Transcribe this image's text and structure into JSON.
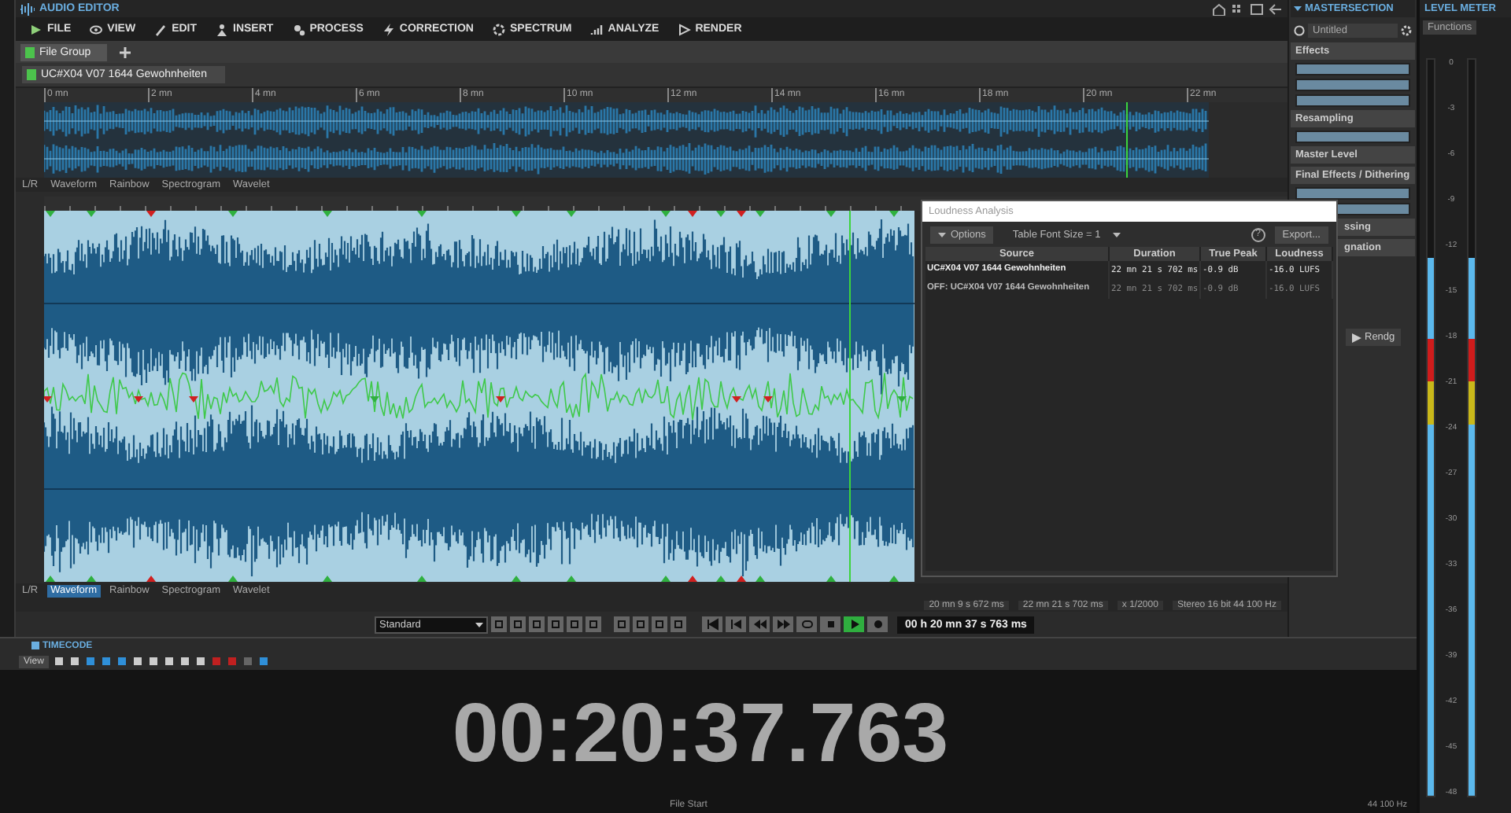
{
  "window": {
    "title": "AUDIO EDITOR"
  },
  "menu": [
    "FILE",
    "VIEW",
    "EDIT",
    "INSERT",
    "PROCESS",
    "CORRECTION",
    "SPECTRUM",
    "ANALYZE",
    "RENDER"
  ],
  "file_group_tab": "File Group",
  "file_tab": "UC#X04 V07 1644 Gewohnheiten",
  "overview": {
    "ruler": [
      "0 mn",
      "2 mn",
      "4 mn",
      "6 mn",
      "8 mn",
      "10 mn",
      "12 mn",
      "14 mn",
      "16 mn",
      "18 mn",
      "20 mn",
      "22 mn"
    ],
    "channel_label": "L/R",
    "view_tabs": [
      {
        "label": "Waveform",
        "selected": false
      },
      {
        "label": "Rainbow",
        "selected": false
      },
      {
        "label": "Spectrogram",
        "selected": false
      },
      {
        "label": "Wavelet",
        "selected": false
      }
    ]
  },
  "main_view": {
    "channel_label": "L/R",
    "view_tabs": [
      {
        "label": "Waveform",
        "selected": true
      },
      {
        "label": "Rainbow",
        "selected": false
      },
      {
        "label": "Spectrogram",
        "selected": false
      },
      {
        "label": "Wavelet",
        "selected": false
      }
    ],
    "status": [
      "20 mn 9 s 672 ms",
      "22 mn 21 s 702 ms",
      "x 1/2000",
      "Stereo 16 bit 44 100 Hz"
    ]
  },
  "transport": {
    "preset": "Standard",
    "time": "00 h 20 mn 37 s 763 ms",
    "buttons": [
      {
        "kind": "to-start",
        "active": false
      },
      {
        "kind": "prev",
        "active": false
      },
      {
        "kind": "rewind",
        "active": false
      },
      {
        "kind": "forward",
        "active": false
      },
      {
        "kind": "loop",
        "active": false
      },
      {
        "kind": "stop",
        "active": false
      },
      {
        "kind": "play",
        "active": true
      },
      {
        "kind": "record",
        "active": false
      }
    ]
  },
  "loudness": {
    "title": "Loudness Analysis",
    "options": "Options",
    "font_size": "Table Font Size = 1",
    "help": "?",
    "export": "Export...",
    "columns": [
      "Source",
      "Duration",
      "True Peak",
      "Loudness"
    ],
    "rows": [
      {
        "source": "UC#X04 V07 1644 Gewohnheiten",
        "duration": "22 mn 21 s 702 ms",
        "true_peak": "-0.9 dB",
        "loudness": "-16.0 LUFS",
        "selected": true
      },
      {
        "source": "OFF: UC#X04 V07 1644 Gewohnheiten",
        "duration": "22 mn 21 s 702 ms",
        "true_peak": "-0.9 dB",
        "loudness": "-16.0 LUFS",
        "selected": false
      }
    ]
  },
  "master_section": {
    "title": "MASTERSECTION",
    "preset": "Untitled",
    "sections": [
      "Effects",
      "Resampling",
      "Master Level",
      "Final Effects / Dithering",
      "ssing",
      "gnation"
    ],
    "render": "Rendg"
  },
  "level_meter": {
    "title": "LEVEL METER",
    "functions": "Functions",
    "scale": [
      "0",
      "-3",
      "-6",
      "-9",
      "-12",
      "-15",
      "-18",
      "-21",
      "-24",
      "-27",
      "-30",
      "-33",
      "-36",
      "-39",
      "-42",
      "-45",
      "-48"
    ],
    "channels": [
      {
        "level": 0.73
      },
      {
        "level": 0.73
      }
    ]
  },
  "timecode": {
    "title": "TIMECODE",
    "view": "View",
    "time": "00:20:37.763",
    "origin": "File Start",
    "rate": "44 100 Hz"
  }
}
